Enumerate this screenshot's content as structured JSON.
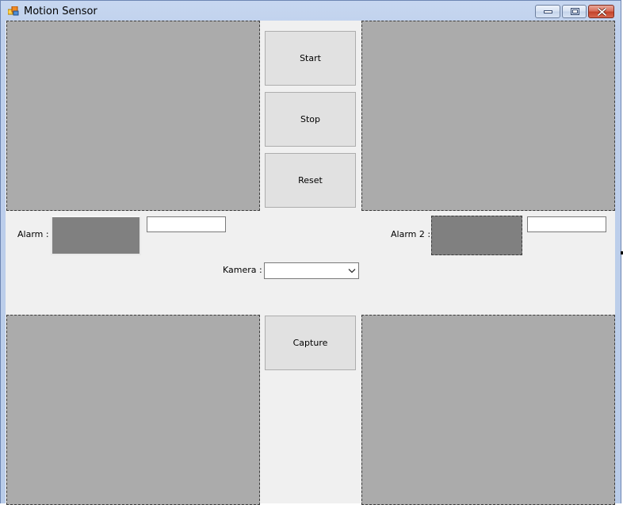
{
  "window": {
    "title": "Motion Sensor",
    "icon": "app-icon",
    "controls": [
      "minimize-icon",
      "maximize-icon",
      "close-icon"
    ]
  },
  "buttons": {
    "start": "Start",
    "stop": "Stop",
    "reset": "Reset",
    "capture": "Capture"
  },
  "alarm1": {
    "label": "Alarm :",
    "value": ""
  },
  "alarm2": {
    "label": "Alarm 2 :",
    "value": ""
  },
  "camera": {
    "label": "Kamera :",
    "selected": ""
  },
  "colors": {
    "picture_box": "#ababab",
    "alarm_indicator": "#808080",
    "form_background": "#f0f0f0",
    "button_face": "#e1e1e1"
  }
}
